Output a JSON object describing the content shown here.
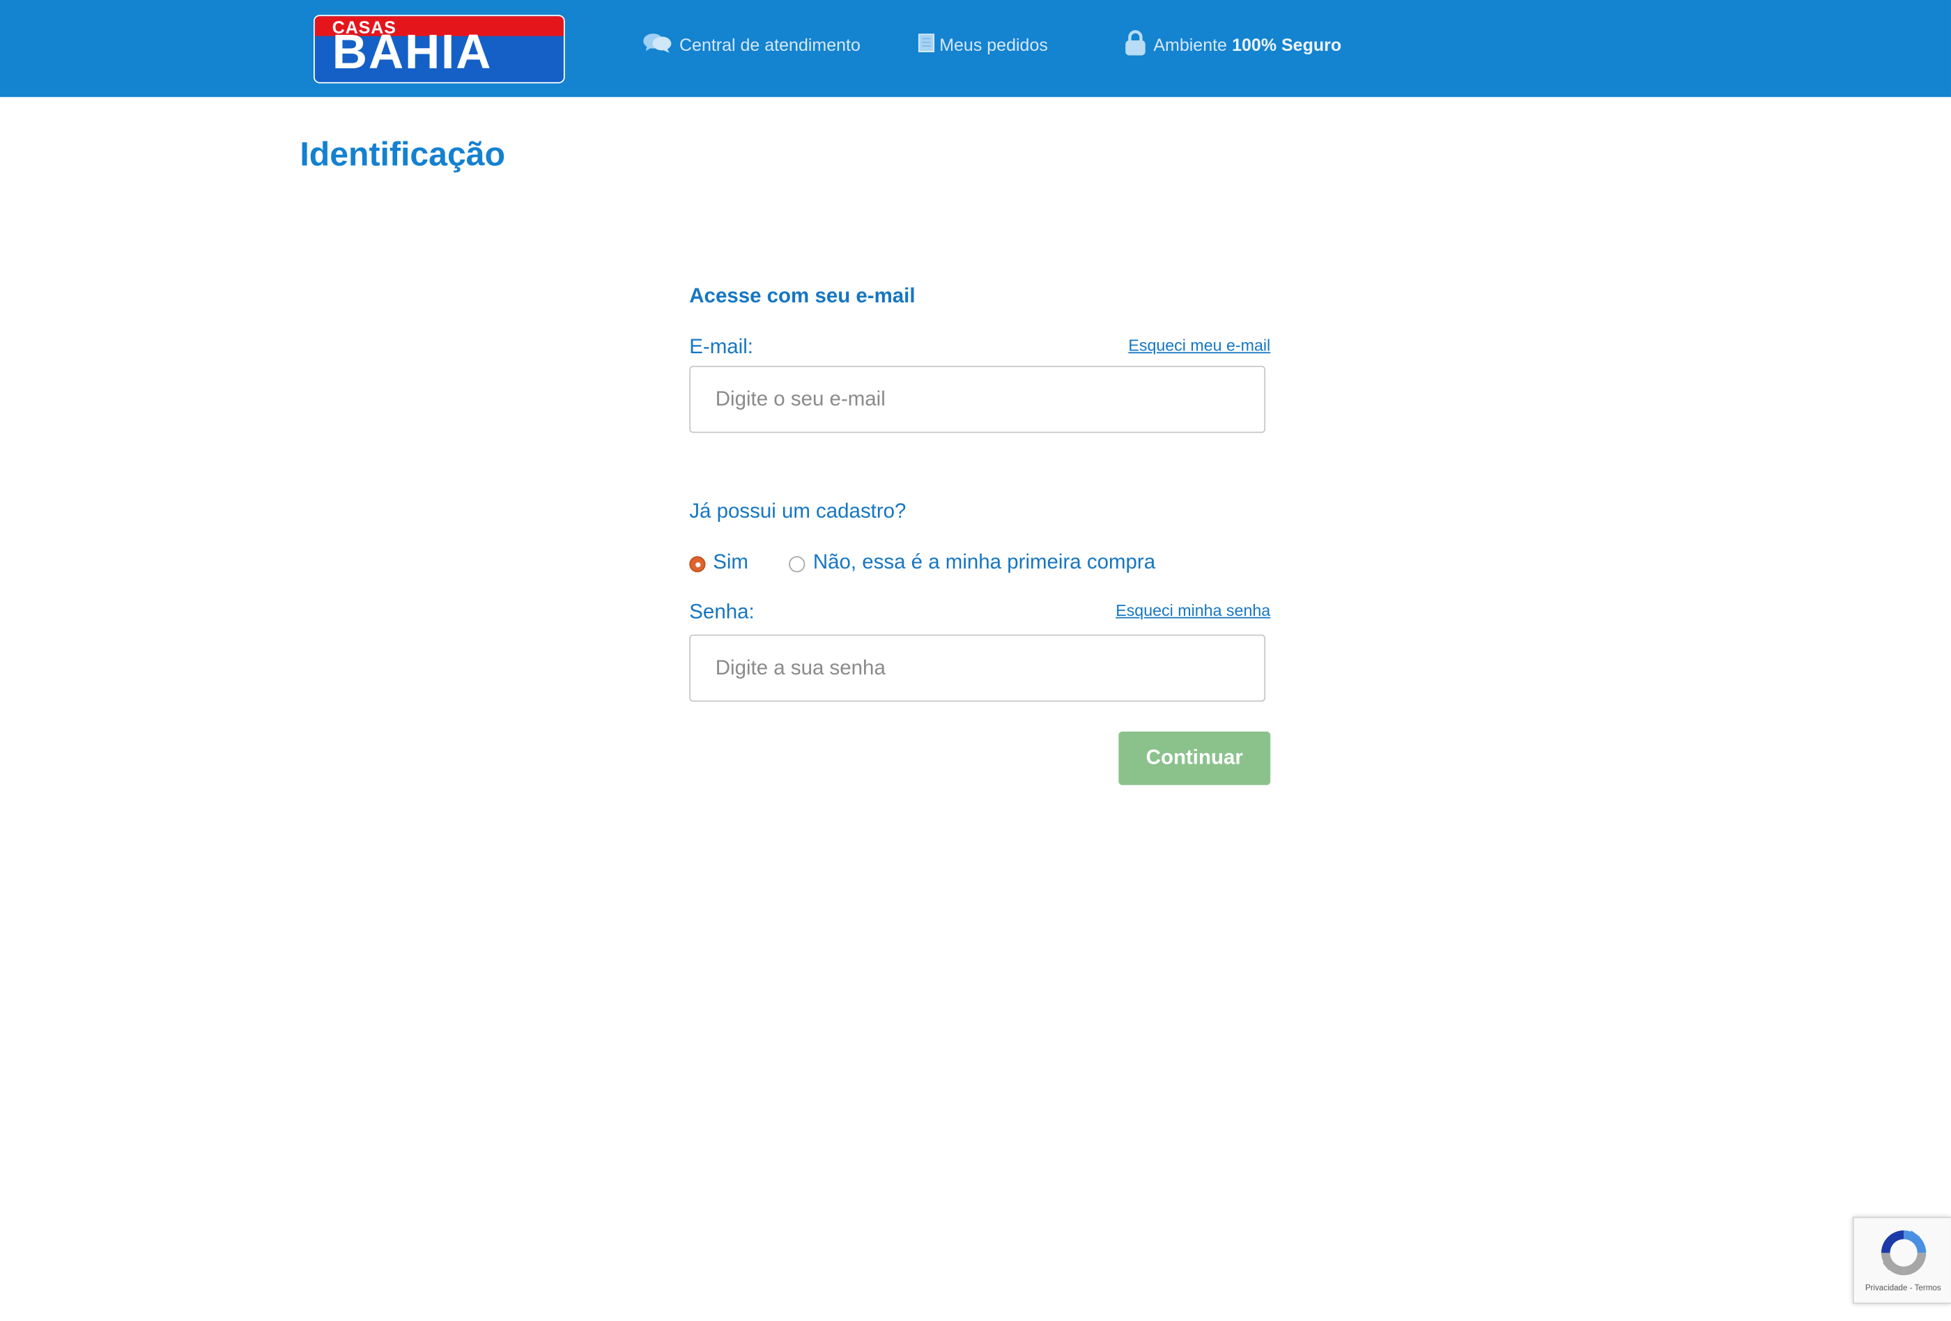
{
  "header": {
    "logo": {
      "top_text": "CASAS",
      "main_text": "BAHIA"
    },
    "nav": [
      {
        "label": "Central de atendimento",
        "icon": "chat-bubbles-icon"
      },
      {
        "label": "Meus pedidos",
        "icon": "document-icon"
      }
    ],
    "security": {
      "prefix": "Ambiente",
      "emphasis": "100% Seguro",
      "icon": "lock-icon"
    },
    "colors": {
      "background": "#1483d0"
    }
  },
  "page": {
    "title": "Identificação"
  },
  "form": {
    "subtitle": "Acesse com seu e-mail",
    "email": {
      "label": "E-mail:",
      "forgot_link": "Esqueci meu e-mail",
      "placeholder": "Digite o seu e-mail",
      "value": ""
    },
    "registered_question": "Já possui um cadastro?",
    "registered_options": [
      {
        "label": "Sim",
        "selected": true
      },
      {
        "label": "Não, essa é a minha primeira compra",
        "selected": false
      }
    ],
    "password": {
      "label": "Senha:",
      "forgot_link": "Esqueci minha senha",
      "placeholder": "Digite a sua senha",
      "value": ""
    },
    "submit_label": "Continuar",
    "colors": {
      "text": "#1576c2",
      "submit": "#8bc28c",
      "radio_selected": "#e0622e"
    }
  },
  "recaptcha": {
    "legal_text": "Privacidade - Termos",
    "icon": "recaptcha-icon"
  }
}
